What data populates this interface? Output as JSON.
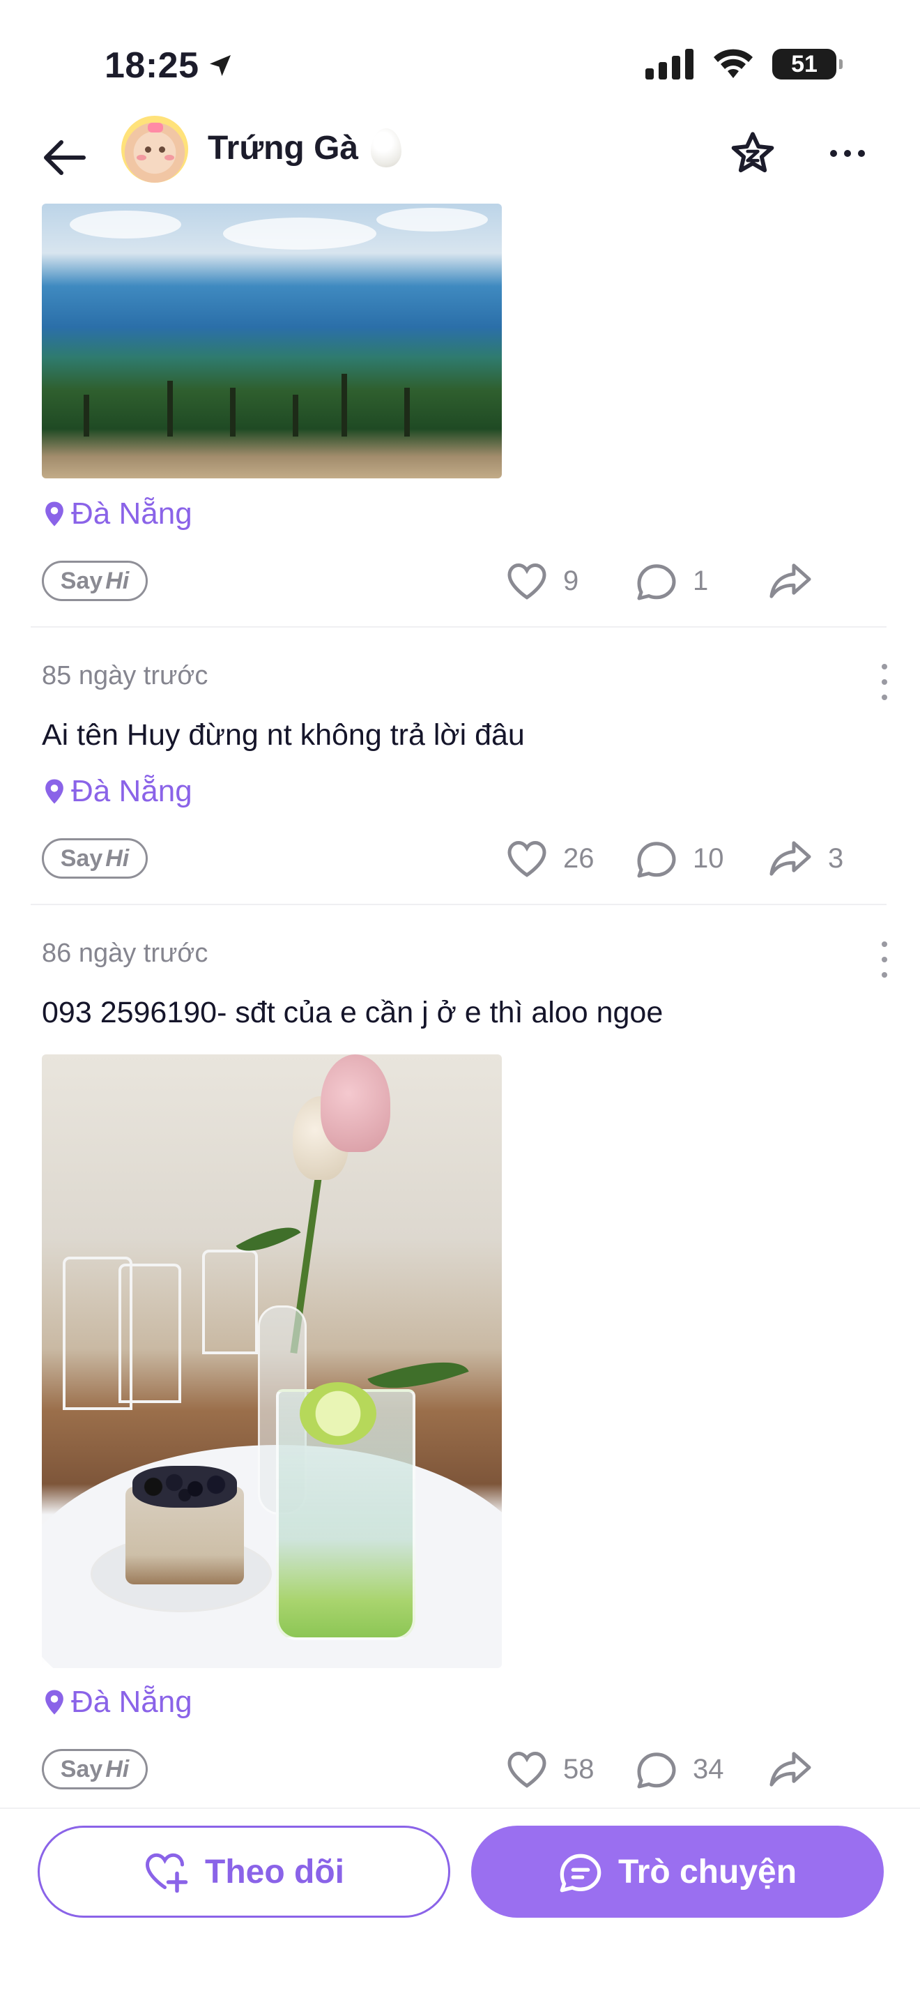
{
  "status_bar": {
    "time": "18:25",
    "battery": "51"
  },
  "header": {
    "title": "Trứng Gà",
    "back_icon": "back-arrow-icon",
    "favorite_icon": "star-icon",
    "more_icon": "more-icon"
  },
  "posts": [
    {
      "time": "",
      "text": "",
      "location": "Đà Nẵng",
      "image": "beach-photo",
      "say_hi": {
        "say": "Say",
        "hi": "Hi"
      },
      "likes": "9",
      "comments": "1",
      "shares": ""
    },
    {
      "time": "85 ngày trước",
      "text": "Ai tên Huy đừng nt không trả lời đâu",
      "location": "Đà Nẵng",
      "say_hi": {
        "say": "Say",
        "hi": "Hi"
      },
      "likes": "26",
      "comments": "10",
      "shares": "3"
    },
    {
      "time": "86 ngày trước",
      "text": "093 2596190- sđt của e cần j ở e thì aloo ngoe",
      "location": "Đà Nẵng",
      "image": "cafe-drink-photo",
      "say_hi": {
        "say": "Say",
        "hi": "Hi"
      },
      "likes": "58",
      "comments": "34",
      "shares": ""
    }
  ],
  "bottom_bar": {
    "follow_label": "Theo dõi",
    "chat_label": "Trò chuyện"
  },
  "colors": {
    "accent": "#8a63e8",
    "chat_button": "#9a6ff0",
    "muted_text": "#85858f"
  }
}
